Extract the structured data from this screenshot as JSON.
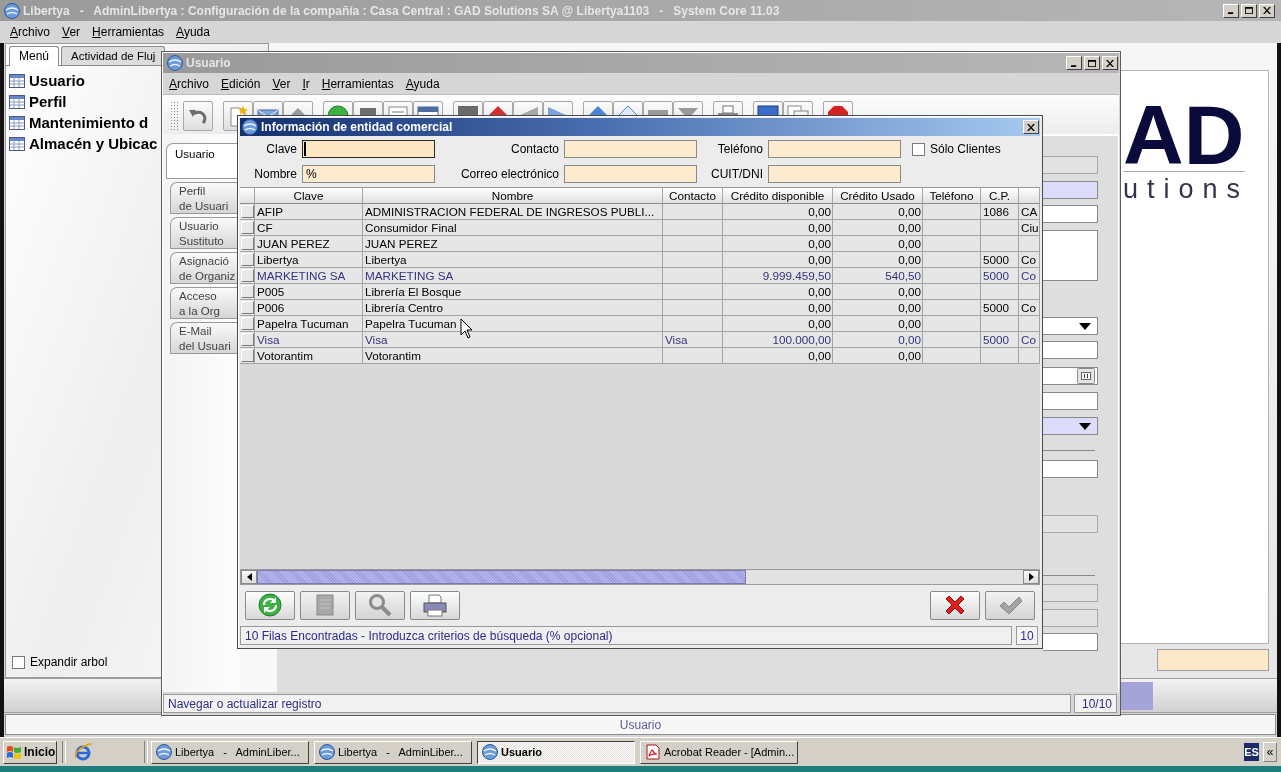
{
  "main_window": {
    "title": "Libertya   -   AdminLibertya : Configuración de la compañía : Casa Central : GAD Solutions SA @ Libertya1103   -   System Core 11.03",
    "active": false,
    "menu": [
      "Archivo",
      "Ver",
      "Herramientas",
      "Ayuda"
    ],
    "left_panel": {
      "tabs": [
        {
          "label": "Menú",
          "selected": true
        },
        {
          "label": "Actividad de Fluj",
          "selected": false
        }
      ],
      "tree": [
        {
          "label": "Usuario"
        },
        {
          "label": "Perfil"
        },
        {
          "label": "Mantenimiento d"
        },
        {
          "label": "Almacén y Ubicac"
        }
      ],
      "expand_tree": {
        "label": "Expandir arbol",
        "checked": false
      }
    },
    "logo": {
      "mark": "AD",
      "tagline": "utions"
    },
    "status_bar": "Usuario"
  },
  "usuario_window": {
    "title": "Usuario",
    "active": false,
    "menu": [
      "Archivo",
      "Edición",
      "Ver",
      "Ir",
      "Herramientas",
      "Ayuda"
    ],
    "tabs": [
      {
        "label": "Usuario",
        "selected": true
      },
      {
        "label": "Perfil\nde Usuari",
        "selected": false
      },
      {
        "label": "Usuario\nSustituto",
        "selected": false
      },
      {
        "label": "Asignació\nde Organiz",
        "selected": false
      },
      {
        "label": "Acceso\na la Org",
        "selected": false
      },
      {
        "label": "E-Mail\ndel Usuari",
        "selected": false
      }
    ],
    "form": [
      {
        "kind": "text",
        "disabled": true,
        "mandatory": false
      },
      {
        "kind": "text",
        "disabled": false,
        "mandatory": true
      },
      {
        "kind": "text",
        "disabled": false,
        "mandatory": false
      },
      {
        "kind": "textarea",
        "disabled": false,
        "mandatory": false
      },
      {
        "kind": "dropdown",
        "disabled": false,
        "mandatory": false
      },
      {
        "kind": "text",
        "disabled": false,
        "mandatory": false
      },
      {
        "kind": "lookup",
        "disabled": false,
        "mandatory": false
      },
      {
        "kind": "text",
        "disabled": false,
        "mandatory": false
      },
      {
        "kind": "dropdown",
        "disabled": false,
        "mandatory": true
      },
      {
        "kind": "separator"
      },
      {
        "kind": "text",
        "disabled": false,
        "mandatory": false
      },
      {
        "kind": "text",
        "disabled": true,
        "mandatory": false
      },
      {
        "kind": "separator"
      },
      {
        "kind": "text",
        "disabled": true,
        "mandatory": false
      },
      {
        "kind": "text",
        "disabled": true,
        "mandatory": false
      },
      {
        "kind": "text",
        "disabled": false,
        "mandatory": false
      }
    ],
    "status": {
      "message": "Navegar o actualizar registro",
      "record": "10/10"
    }
  },
  "dialog": {
    "title": "Información de entidad comercial",
    "active": true,
    "filters": [
      [
        {
          "label": "Clave",
          "focused": true
        },
        {
          "label": "Contacto",
          "focused": false
        },
        {
          "label": "Teléfono",
          "focused": false
        }
      ],
      [
        {
          "label": "Nombre",
          "value": "%",
          "focused": false
        },
        {
          "label": "Correo electrónico",
          "focused": false
        },
        {
          "label": "CUIT/DNI",
          "focused": false
        }
      ]
    ],
    "only_customers": {
      "label": "Sólo Clientes",
      "checked": false
    },
    "table": {
      "columns": [
        {
          "label": "Clave"
        },
        {
          "label": "Nombre"
        },
        {
          "label": "Contacto"
        },
        {
          "label": "Crédito disponible"
        },
        {
          "label": "Crédito Usado"
        },
        {
          "label": "Teléfono"
        },
        {
          "label": "C.P."
        }
      ],
      "rows": [
        {
          "checked": false,
          "color": "#000000",
          "clave": "AFIP",
          "nombre": "ADMINISTRACION FEDERAL DE INGRESOS PUBLI...",
          "credito_disponible": "0,00",
          "credito_usado": "0,00",
          "cp": "1086",
          "column_9": "CA"
        },
        {
          "checked": false,
          "color": "#000000",
          "clave": "CF",
          "nombre": "Consumidor Final",
          "credito_disponible": "0,00",
          "credito_usado": "0,00",
          "column_9": "Ciu"
        },
        {
          "checked": false,
          "color": "#000000",
          "clave": "JUAN PEREZ",
          "nombre": "JUAN PEREZ",
          "credito_disponible": "0,00",
          "credito_usado": "0,00"
        },
        {
          "checked": false,
          "color": "#000000",
          "clave": "Libertya",
          "nombre": "Libertya",
          "credito_disponible": "0,00",
          "credito_usado": "0,00",
          "cp": "5000",
          "column_9": "Co"
        },
        {
          "checked": false,
          "color": "#33337f",
          "clave": "MARKETING SA",
          "nombre": "MARKETING SA",
          "credito_disponible": "9.999.459,50",
          "credito_usado": "540,50",
          "cp": "5000",
          "column_9": "Co"
        },
        {
          "checked": false,
          "color": "#000000",
          "clave": "P005",
          "nombre": "Librería El Bosque",
          "credito_disponible": "0,00",
          "credito_usado": "0,00"
        },
        {
          "checked": false,
          "color": "#000000",
          "clave": "P006",
          "nombre": "Librería Centro",
          "credito_disponible": "0,00",
          "credito_usado": "0,00",
          "cp": "5000",
          "column_9": "Co"
        },
        {
          "checked": false,
          "color": "#000000",
          "clave": "Papelra Tucuman",
          "nombre": "Papelra Tucuman",
          "credito_disponible": "0,00",
          "credito_usado": "0,00"
        },
        {
          "checked": false,
          "color": "#33337f",
          "clave": "Visa",
          "nombre": "Visa",
          "contacto": "Visa",
          "credito_disponible": "100.000,00",
          "credito_usado": "0,00",
          "cp": "5000",
          "column_9": "Co"
        },
        {
          "checked": false,
          "color": "#000000",
          "clave": "Votorantim",
          "nombre": "Votorantim",
          "credito_disponible": "0,00",
          "credito_usado": "0,00"
        }
      ]
    },
    "tools": [
      {
        "kind": "refresh",
        "disabled": false
      },
      {
        "kind": "history",
        "disabled": true
      },
      {
        "kind": "zoom",
        "disabled": true
      },
      {
        "kind": "print",
        "disabled": false
      }
    ],
    "confirm": [
      {
        "kind": "cancel",
        "disabled": false
      },
      {
        "kind": "ok",
        "disabled": true
      }
    ],
    "status": {
      "message": "10 Filas Encontradas - Introduzca criterios de búsqueda (% opcional)",
      "count": "10"
    }
  },
  "taskbar": {
    "start": "Inicio",
    "tasks": [
      {
        "label": "Libertya   -   AdminLiber...",
        "kind": "libertya",
        "selected": false
      },
      {
        "label": "Libertya   -   AdminLiber...",
        "kind": "libertya",
        "selected": false
      },
      {
        "label": "Usuario",
        "kind": "libertya",
        "selected": true
      },
      {
        "label": "Acrobat Reader - [Admin...",
        "kind": "acrobat",
        "selected": false
      }
    ],
    "language": "ES",
    "tray_toggle": "«"
  }
}
